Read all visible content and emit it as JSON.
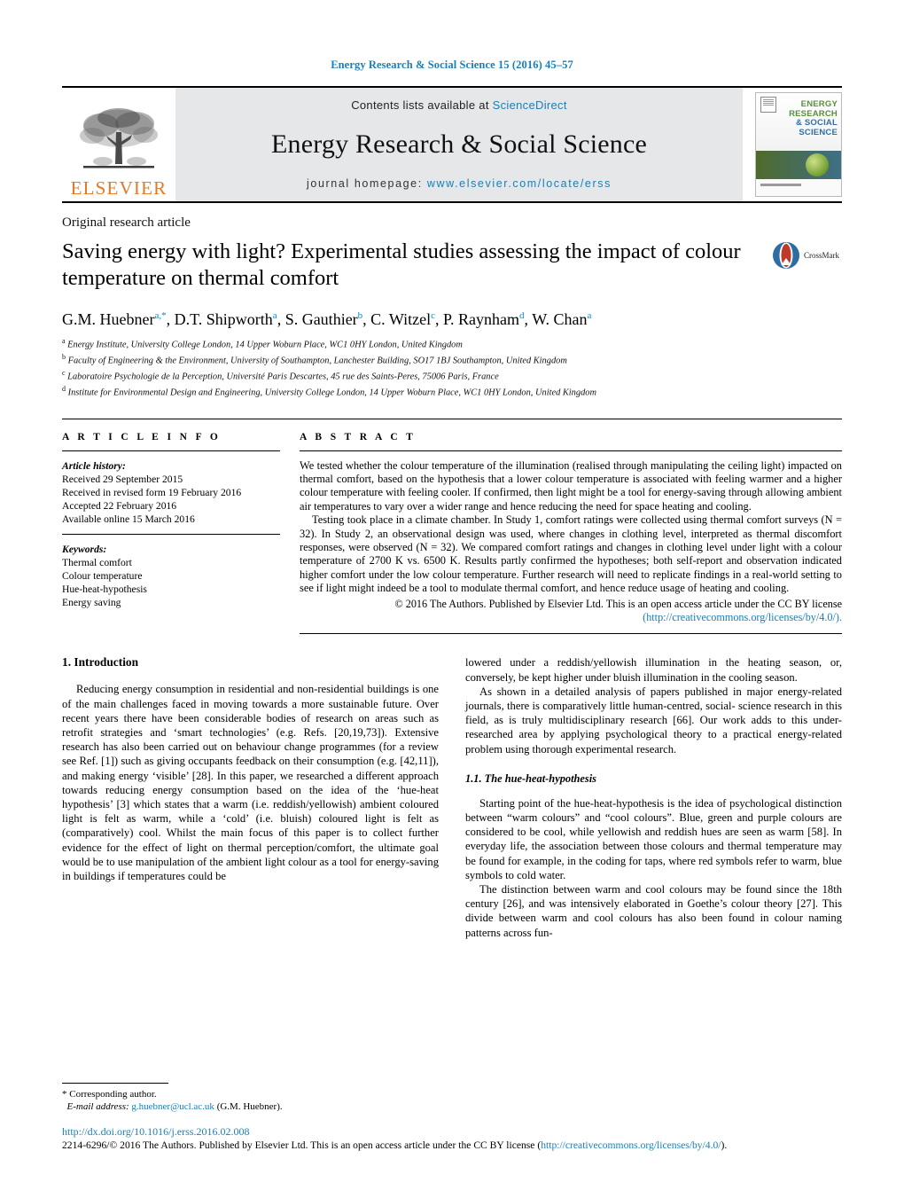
{
  "running_head": "Energy Research & Social Science 15 (2016) 45–57",
  "masthead": {
    "publisher_name": "ELSEVIER",
    "contents_prefix": "Contents lists available at ",
    "contents_link": "ScienceDirect",
    "journal_title": "Energy Research & Social Science",
    "homepage_prefix": "journal homepage: ",
    "homepage_link": "www.elsevier.com/locate/erss",
    "cover": {
      "line1": "ENERGY",
      "line2": "RESEARCH",
      "line3": "& SOCIAL",
      "line4": "SCIENCE"
    }
  },
  "article": {
    "type": "Original research article",
    "title": "Saving energy with light? Experimental studies assessing the impact of colour temperature on thermal comfort",
    "crossmark_label": "CrossMark",
    "authors_html": "G.M. Huebner<sup>a,*</sup>, D.T. Shipworth<sup>a</sup>, S. Gauthier<sup>b</sup>, C. Witzel<sup>c</sup>, P. Raynham<sup>d</sup>, W. Chan<sup>a</sup>",
    "affiliations": [
      "Energy Institute, University College London, 14 Upper Woburn Place, WC1 0HY London, United Kingdom",
      "Faculty of Engineering & the Environment, University of Southampton, Lanchester Building, SO17 1BJ Southampton, United Kingdom",
      "Laboratoire Psychologie de la Perception, Université Paris Descartes, 45 rue des Saints-Peres, 75006 Paris, France",
      "Institute for Environmental Design and Engineering, University College London, 14 Upper Woburn Place, WC1 0HY London, United Kingdom"
    ],
    "affiliation_markers": [
      "a",
      "b",
      "c",
      "d"
    ]
  },
  "article_info": {
    "heading": "A R T I C L E    I N F O",
    "history_label": "Article history:",
    "history": [
      "Received 29 September 2015",
      "Received in revised form 19 February 2016",
      "Accepted 22 February 2016",
      "Available online 15 March 2016"
    ],
    "keywords_label": "Keywords:",
    "keywords": [
      "Thermal comfort",
      "Colour temperature",
      "Hue-heat-hypothesis",
      "Energy saving"
    ]
  },
  "abstract": {
    "heading": "A B S T R A C T",
    "paragraphs": [
      "We tested whether the colour temperature of the illumination (realised through manipulating the ceiling light) impacted on thermal comfort, based on the hypothesis that a lower colour temperature is associated with feeling warmer and a higher colour temperature with feeling cooler. If confirmed, then light might be a tool for energy-saving through allowing ambient air temperatures to vary over a wider range and hence reducing the need for space heating and cooling.",
      "Testing took place in a climate chamber. In Study 1, comfort ratings were collected using thermal comfort surveys (N = 32). In Study 2, an observational design was used, where changes in clothing level, interpreted as thermal discomfort responses, were observed (N = 32). We compared comfort ratings and changes in clothing level under light with a colour temperature of 2700 K vs. 6500 K. Results partly confirmed the hypotheses; both self-report and observation indicated higher comfort under the low colour temperature. Further research will need to replicate findings in a real-world setting to see if light might indeed be a tool to modulate thermal comfort, and hence reduce usage of heating and cooling."
    ],
    "copyright_text": "© 2016 The Authors. Published by Elsevier Ltd. This is an open access article under the CC BY license",
    "copyright_link": "(http://creativecommons.org/licenses/by/4.0/)."
  },
  "body": {
    "section_heading": "1.  Introduction",
    "left_paragraphs": [
      "Reducing energy consumption in residential and non-residential buildings is one of the main challenges faced in moving towards a more sustainable future. Over recent years there have been considerable bodies of research on areas such as retrofit strategies and ‘smart technologies’ (e.g. Refs. [20,19,73]). Extensive research has also been carried out on behaviour change programmes (for a review see Ref. [1]) such as giving occupants feedback on their consumption (e.g. [42,11]), and making energy ‘visible’ [28]. In this paper, we researched a different approach towards reducing energy consumption based on the idea of the ‘hue-heat hypothesis’ [3] which states that a warm (i.e. reddish/yellowish) ambient coloured light is felt as warm, while a ‘cold’ (i.e. bluish) coloured light is felt as (comparatively) cool. Whilst the main focus of this paper is to collect further evidence for the effect of light on thermal perception/comfort, the ultimate goal would be to use manipulation of the ambient light colour as a tool for energy-saving in buildings if temperatures could be"
    ],
    "right_paragraph_1": "lowered under a reddish/yellowish illumination in the heating season, or, conversely, be kept higher under bluish illumination in the cooling season.",
    "right_paragraph_2": "As shown in a detailed analysis of papers published in major energy-related journals, there is comparatively little human-centred, social- science research in this field, as is truly multidisciplinary research [66]. Our work adds to this under-researched area by applying psychological theory to a practical energy-related problem using thorough experimental research.",
    "subsection_heading": "1.1.  The hue-heat-hypothesis",
    "right_paragraph_3": "Starting point of the hue-heat-hypothesis is the idea of psychological distinction between “warm colours” and “cool colours”. Blue, green and purple colours are considered to be cool, while yellowish and reddish hues are seen as warm [58]. In everyday life, the association between those colours and thermal temperature may be found for example, in the coding for taps, where red symbols refer to warm, blue symbols to cold water.",
    "right_paragraph_4": "The distinction between warm and cool colours may be found since the 18th century [26], and was intensively elaborated in Goethe’s colour theory [27]. This divide between warm and cool colours has also been found in colour naming patterns across fun-"
  },
  "footnote": {
    "star": "*",
    "corresponding": "Corresponding author.",
    "email_label": "E-mail address:",
    "email": "g.huebner@ucl.ac.uk",
    "email_owner": "(G.M. Huebner)."
  },
  "footer": {
    "doi": "http://dx.doi.org/10.1016/j.erss.2016.02.008",
    "issn_copyright": "2214-6296/© 2016 The Authors. Published by Elsevier Ltd. This is an open access article under the CC BY license (",
    "license_url": "http://creativecommons.org/licenses/by/4.0/",
    "license_tail": ")."
  },
  "colors": {
    "link_blue": "#1a7fb5",
    "elsevier_orange": "#E87722",
    "band_grey": "#e6e7e8"
  }
}
